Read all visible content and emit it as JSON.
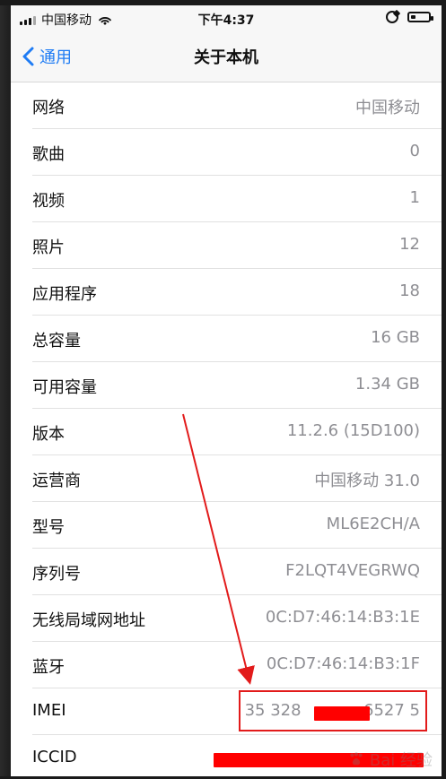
{
  "status_bar": {
    "carrier": "中国移动",
    "time": "下午4:37",
    "battery_level": 0.25
  },
  "nav": {
    "back_label": "通用",
    "title": "关于本机"
  },
  "rows": [
    {
      "label": "网络",
      "value": "中国移动"
    },
    {
      "label": "歌曲",
      "value": "0"
    },
    {
      "label": "视频",
      "value": "1"
    },
    {
      "label": "照片",
      "value": "12"
    },
    {
      "label": "应用程序",
      "value": "18"
    },
    {
      "label": "总容量",
      "value": "16 GB"
    },
    {
      "label": "可用容量",
      "value": "1.34 GB"
    },
    {
      "label": "版本",
      "value": "11.2.6 (15D100)"
    },
    {
      "label": "运营商",
      "value": "中国移动 31.0"
    },
    {
      "label": "型号",
      "value": "ML6E2CH/A"
    },
    {
      "label": "序列号",
      "value": "F2LQT4VEGRWQ"
    },
    {
      "label": "无线局域网地址",
      "value": "0C:D7:46:14:B3:1E"
    },
    {
      "label": "蓝牙",
      "value": "0C:D7:46:14:B3:1F"
    },
    {
      "label": "IMEI",
      "value": "35 328",
      "value_suffix": "6527 5"
    },
    {
      "label": "ICCID",
      "value": ""
    }
  ],
  "watermark": {
    "text": "Bai 经验"
  },
  "colors": {
    "ios_blue": "#1f7cf4",
    "annotation_red": "#e21b1b",
    "redaction_red": "#ff0000",
    "value_gray": "#8e8e93"
  },
  "icons": {
    "signal": "signal-bars-icon",
    "wifi": "wifi-icon",
    "rotation_lock": "rotation-lock-icon",
    "battery": "battery-icon",
    "back": "chevron-left-icon",
    "watermark": "baidu-paw-icon"
  }
}
